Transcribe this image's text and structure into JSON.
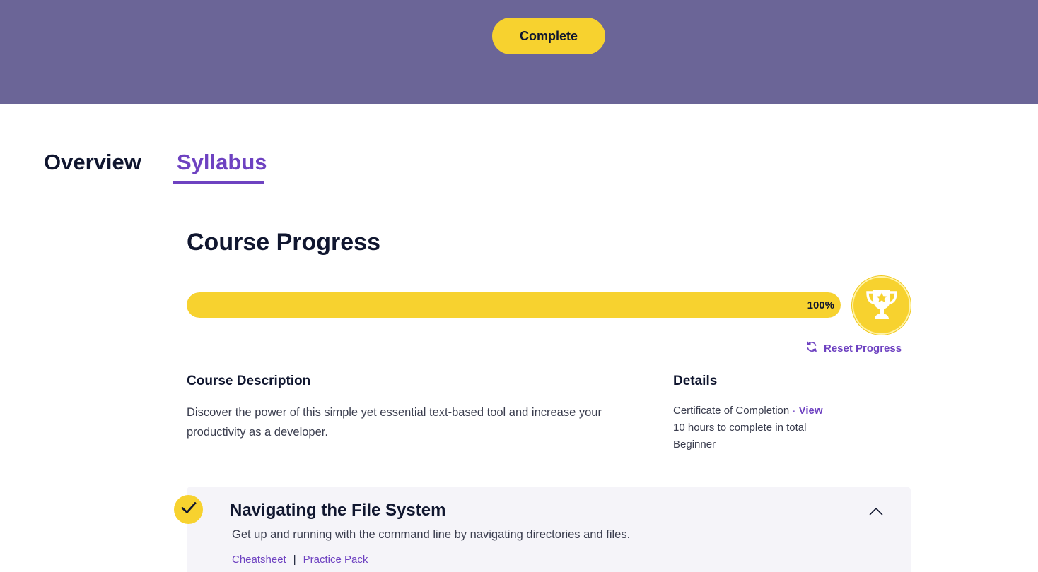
{
  "hero": {
    "complete_label": "Complete",
    "background": "#6b6597",
    "button_color": "#f7d22f"
  },
  "tabs": [
    {
      "label": "Overview",
      "active": false
    },
    {
      "label": "Syllabus",
      "active": true
    }
  ],
  "progress": {
    "title": "Course Progress",
    "value": 1.0,
    "percent_label": "100%",
    "badge_icon": "trophy-icon",
    "reset_label": "Reset Progress",
    "reset_icon": "refresh-icon"
  },
  "description": {
    "heading": "Course Description",
    "text": "Discover the power of this simple yet essential text-based tool and increase your productivity as a developer."
  },
  "details": {
    "heading": "Details",
    "certificate": "Certificate of Completion",
    "separator": "·",
    "view_label": "View",
    "duration": "10 hours to complete in total",
    "level": "Beginner"
  },
  "module": {
    "status_icon": "checkmark-icon",
    "completed": true,
    "title": "Navigating the File System",
    "description": "Get up and running with the command line by navigating directories and files.",
    "links": [
      "Cheatsheet",
      "Practice Pack"
    ],
    "link_separator": "|",
    "toggle_icon": "chevron-up-icon"
  },
  "colors": {
    "accent": "#6e42c1",
    "yellow": "#f7d22f",
    "text": "#10162f"
  }
}
